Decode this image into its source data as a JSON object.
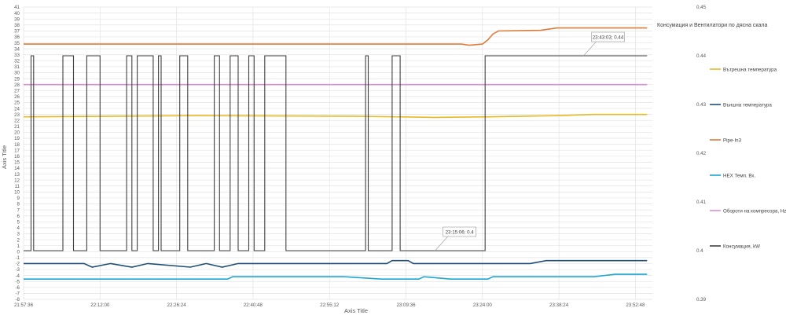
{
  "chart_data": {
    "type": "line",
    "xlabel": "Axis Title",
    "ylabel": "Axis Title",
    "x_ticks": [
      "21:57:36",
      "22:12:00",
      "22:26:24",
      "22:40:48",
      "22:55:12",
      "23:09:36",
      "23:24:00",
      "23:38:24",
      "23:52:48"
    ],
    "y_left": {
      "min": -8,
      "max": 41,
      "step": 1
    },
    "y_right": {
      "min": 0.39,
      "max": 0.45,
      "ticks": [
        0.39,
        0.4,
        0.41,
        0.42,
        0.43,
        0.44,
        0.45
      ]
    },
    "grid": true,
    "legend_position": "right",
    "secondary_axis_note": "Консумация и Вентилатори по дясна скала",
    "series": [
      {
        "name": "Външна температура",
        "color": "#1F4E79",
        "axis": "left",
        "points": [
          [
            "21:57:36",
            -2.0
          ],
          [
            "22:09:00",
            -2.0
          ],
          [
            "22:10:30",
            -2.6
          ],
          [
            "22:14:00",
            -2.0
          ],
          [
            "22:18:00",
            -2.6
          ],
          [
            "22:21:00",
            -2.0
          ],
          [
            "22:29:00",
            -2.6
          ],
          [
            "22:32:00",
            -2.0
          ],
          [
            "22:35:00",
            -2.6
          ],
          [
            "22:38:00",
            -2.0
          ],
          [
            "23:06:00",
            -2.0
          ],
          [
            "23:07:00",
            -1.5
          ],
          [
            "23:10:00",
            -1.5
          ],
          [
            "23:11:00",
            -2.0
          ],
          [
            "23:33:00",
            -2.0
          ],
          [
            "23:36:00",
            -1.5
          ],
          [
            "23:39:00",
            -1.5
          ],
          [
            "23:41:00",
            -1.5
          ],
          [
            "23:55:00",
            -1.5
          ]
        ]
      },
      {
        "name": "Вътрешна температура",
        "color": "#E8B923",
        "axis": "left",
        "points": [
          [
            "21:57:36",
            22.6
          ],
          [
            "22:30:00",
            22.8
          ],
          [
            "23:00:00",
            22.7
          ],
          [
            "23:15:00",
            22.5
          ],
          [
            "23:25:00",
            22.6
          ],
          [
            "23:38:00",
            22.8
          ],
          [
            "23:45:00",
            23.0
          ],
          [
            "23:55:00",
            23.0
          ]
        ]
      },
      {
        "name": "Pipe-In3",
        "color": "#E07B39",
        "axis": "left",
        "points": [
          [
            "21:57:36",
            34.8
          ],
          [
            "23:20:00",
            34.8
          ],
          [
            "23:21:30",
            34.6
          ],
          [
            "23:24:00",
            34.8
          ],
          [
            "23:25:00",
            35.5
          ],
          [
            "23:26:00",
            36.5
          ],
          [
            "23:27:00",
            37.0
          ],
          [
            "23:35:00",
            37.1
          ],
          [
            "23:38:00",
            37.5
          ],
          [
            "23:55:00",
            37.5
          ]
        ]
      },
      {
        "name": "HEX Темп. Вх.",
        "color": "#1EA7D1",
        "axis": "left",
        "points": [
          [
            "21:57:36",
            -4.6
          ],
          [
            "22:36:00",
            -4.6
          ],
          [
            "22:37:00",
            -4.2
          ],
          [
            "22:58:00",
            -4.2
          ],
          [
            "23:05:00",
            -4.6
          ],
          [
            "23:12:00",
            -4.6
          ],
          [
            "23:13:00",
            -4.2
          ],
          [
            "23:18:00",
            -4.6
          ],
          [
            "23:25:00",
            -4.6
          ],
          [
            "23:26:00",
            -4.2
          ],
          [
            "23:45:00",
            -4.2
          ],
          [
            "23:49:00",
            -3.8
          ],
          [
            "23:55:00",
            -3.8
          ]
        ]
      },
      {
        "name": "Обороти на компресора, Hz",
        "color": "#D98FD6",
        "axis": "left",
        "points": [
          [
            "21:57:36",
            28.0
          ],
          [
            "23:55:00",
            28.0
          ]
        ]
      },
      {
        "name": "Консумация, kW",
        "color": "#404040",
        "axis": "right",
        "points": [
          [
            "21:57:36",
            0.4
          ],
          [
            "21:59:00",
            0.4
          ],
          [
            "21:59:00",
            0.44
          ],
          [
            "21:59:30",
            0.44
          ],
          [
            "21:59:30",
            0.4
          ],
          [
            "22:05:00",
            0.4
          ],
          [
            "22:05:00",
            0.44
          ],
          [
            "22:07:00",
            0.44
          ],
          [
            "22:07:00",
            0.4
          ],
          [
            "22:09:30",
            0.4
          ],
          [
            "22:09:30",
            0.44
          ],
          [
            "22:12:00",
            0.44
          ],
          [
            "22:12:00",
            0.4
          ],
          [
            "22:17:00",
            0.4
          ],
          [
            "22:17:00",
            0.44
          ],
          [
            "22:18:00",
            0.44
          ],
          [
            "22:18:00",
            0.4
          ],
          [
            "22:19:00",
            0.4
          ],
          [
            "22:19:00",
            0.44
          ],
          [
            "22:22:00",
            0.44
          ],
          [
            "22:22:00",
            0.4
          ],
          [
            "22:23:00",
            0.4
          ],
          [
            "22:23:00",
            0.44
          ],
          [
            "22:23:30",
            0.44
          ],
          [
            "22:23:30",
            0.4
          ],
          [
            "22:27:00",
            0.4
          ],
          [
            "22:27:00",
            0.44
          ],
          [
            "22:28:30",
            0.44
          ],
          [
            "22:28:30",
            0.4
          ],
          [
            "22:33:30",
            0.4
          ],
          [
            "22:33:30",
            0.44
          ],
          [
            "22:34:30",
            0.44
          ],
          [
            "22:34:30",
            0.4
          ],
          [
            "22:36:30",
            0.4
          ],
          [
            "22:36:30",
            0.44
          ],
          [
            "22:38:00",
            0.44
          ],
          [
            "22:38:00",
            0.4
          ],
          [
            "22:40:00",
            0.4
          ],
          [
            "22:40:00",
            0.44
          ],
          [
            "22:41:00",
            0.44
          ],
          [
            "22:41:00",
            0.4
          ],
          [
            "22:43:00",
            0.4
          ],
          [
            "22:43:00",
            0.44
          ],
          [
            "22:47:00",
            0.44
          ],
          [
            "22:47:00",
            0.4
          ],
          [
            "23:02:00",
            0.4
          ],
          [
            "23:02:00",
            0.44
          ],
          [
            "23:02:30",
            0.44
          ],
          [
            "23:02:30",
            0.4
          ],
          [
            "23:07:00",
            0.4
          ],
          [
            "23:07:00",
            0.44
          ],
          [
            "23:08:30",
            0.44
          ],
          [
            "23:08:30",
            0.4
          ],
          [
            "23:15:06",
            0.4
          ],
          [
            "23:24:30",
            0.4
          ],
          [
            "23:24:30",
            0.44
          ],
          [
            "23:43:03",
            0.44
          ],
          [
            "23:55:00",
            0.44
          ]
        ]
      }
    ],
    "annotations": [
      {
        "x": "23:15:06",
        "y": 0.4,
        "axis": "right",
        "text": "23:15:06; 0.4"
      },
      {
        "x": "23:43:03",
        "y": 0.44,
        "axis": "right",
        "text": "23:43:03; 0.44"
      }
    ]
  }
}
